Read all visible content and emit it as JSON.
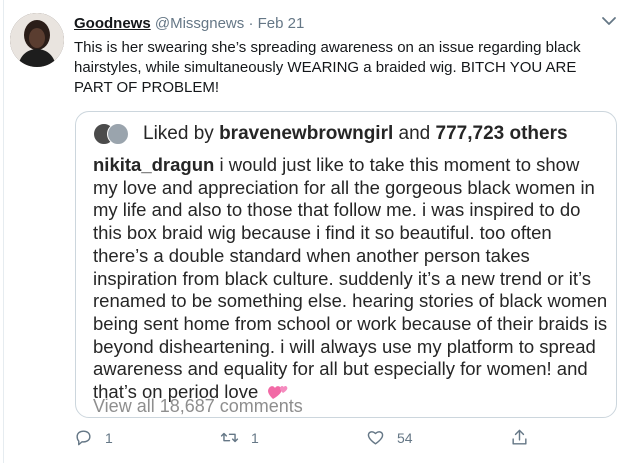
{
  "tweet": {
    "display_name": "Goodnews",
    "handle": "@Missgnews",
    "separator": "·",
    "date": "Feb 21",
    "text": "This is her swearing she’s spreading awareness on an issue regarding black hairstyles, while simultaneously WEARING a braided wig. BITCH YOU ARE PART OF PROBLEM!"
  },
  "quote": {
    "liked_by_prefix": "Liked by",
    "liked_by_user": "bravenewbrowngirl",
    "liked_by_and": "and",
    "liked_by_count": "777,723 others",
    "caption_user": "nikita_dragun",
    "caption_text": "i would just like to take this moment to show my love and appreciation for all the gorgeous black women in my life and also to those that follow me. i was inspired to do this box braid wig because i find it so beautiful. too often there’s a double standard when another person takes inspiration from black culture. suddenly it’s a new trend or it’s renamed to be something else. hearing stories of black women being sent home from school or work because of their braids is beyond disheartening. i will always use my platform to spread awareness and equality for all but especially for women! and that’s on period love",
    "view_all": "View all 18,687 comments"
  },
  "actions": {
    "reply_count": "1",
    "retweet_count": "1",
    "like_count": "54"
  },
  "icons": {
    "reply": "reply-icon",
    "retweet": "retweet-icon",
    "like": "heart-icon",
    "share": "share-icon",
    "menu": "chevron-down-icon",
    "emoji": "two-hearts-emoji"
  },
  "colors": {
    "secondary_text": "#657786",
    "card_border": "#ccd6dd",
    "emoji_pink": "#f26aa6"
  }
}
